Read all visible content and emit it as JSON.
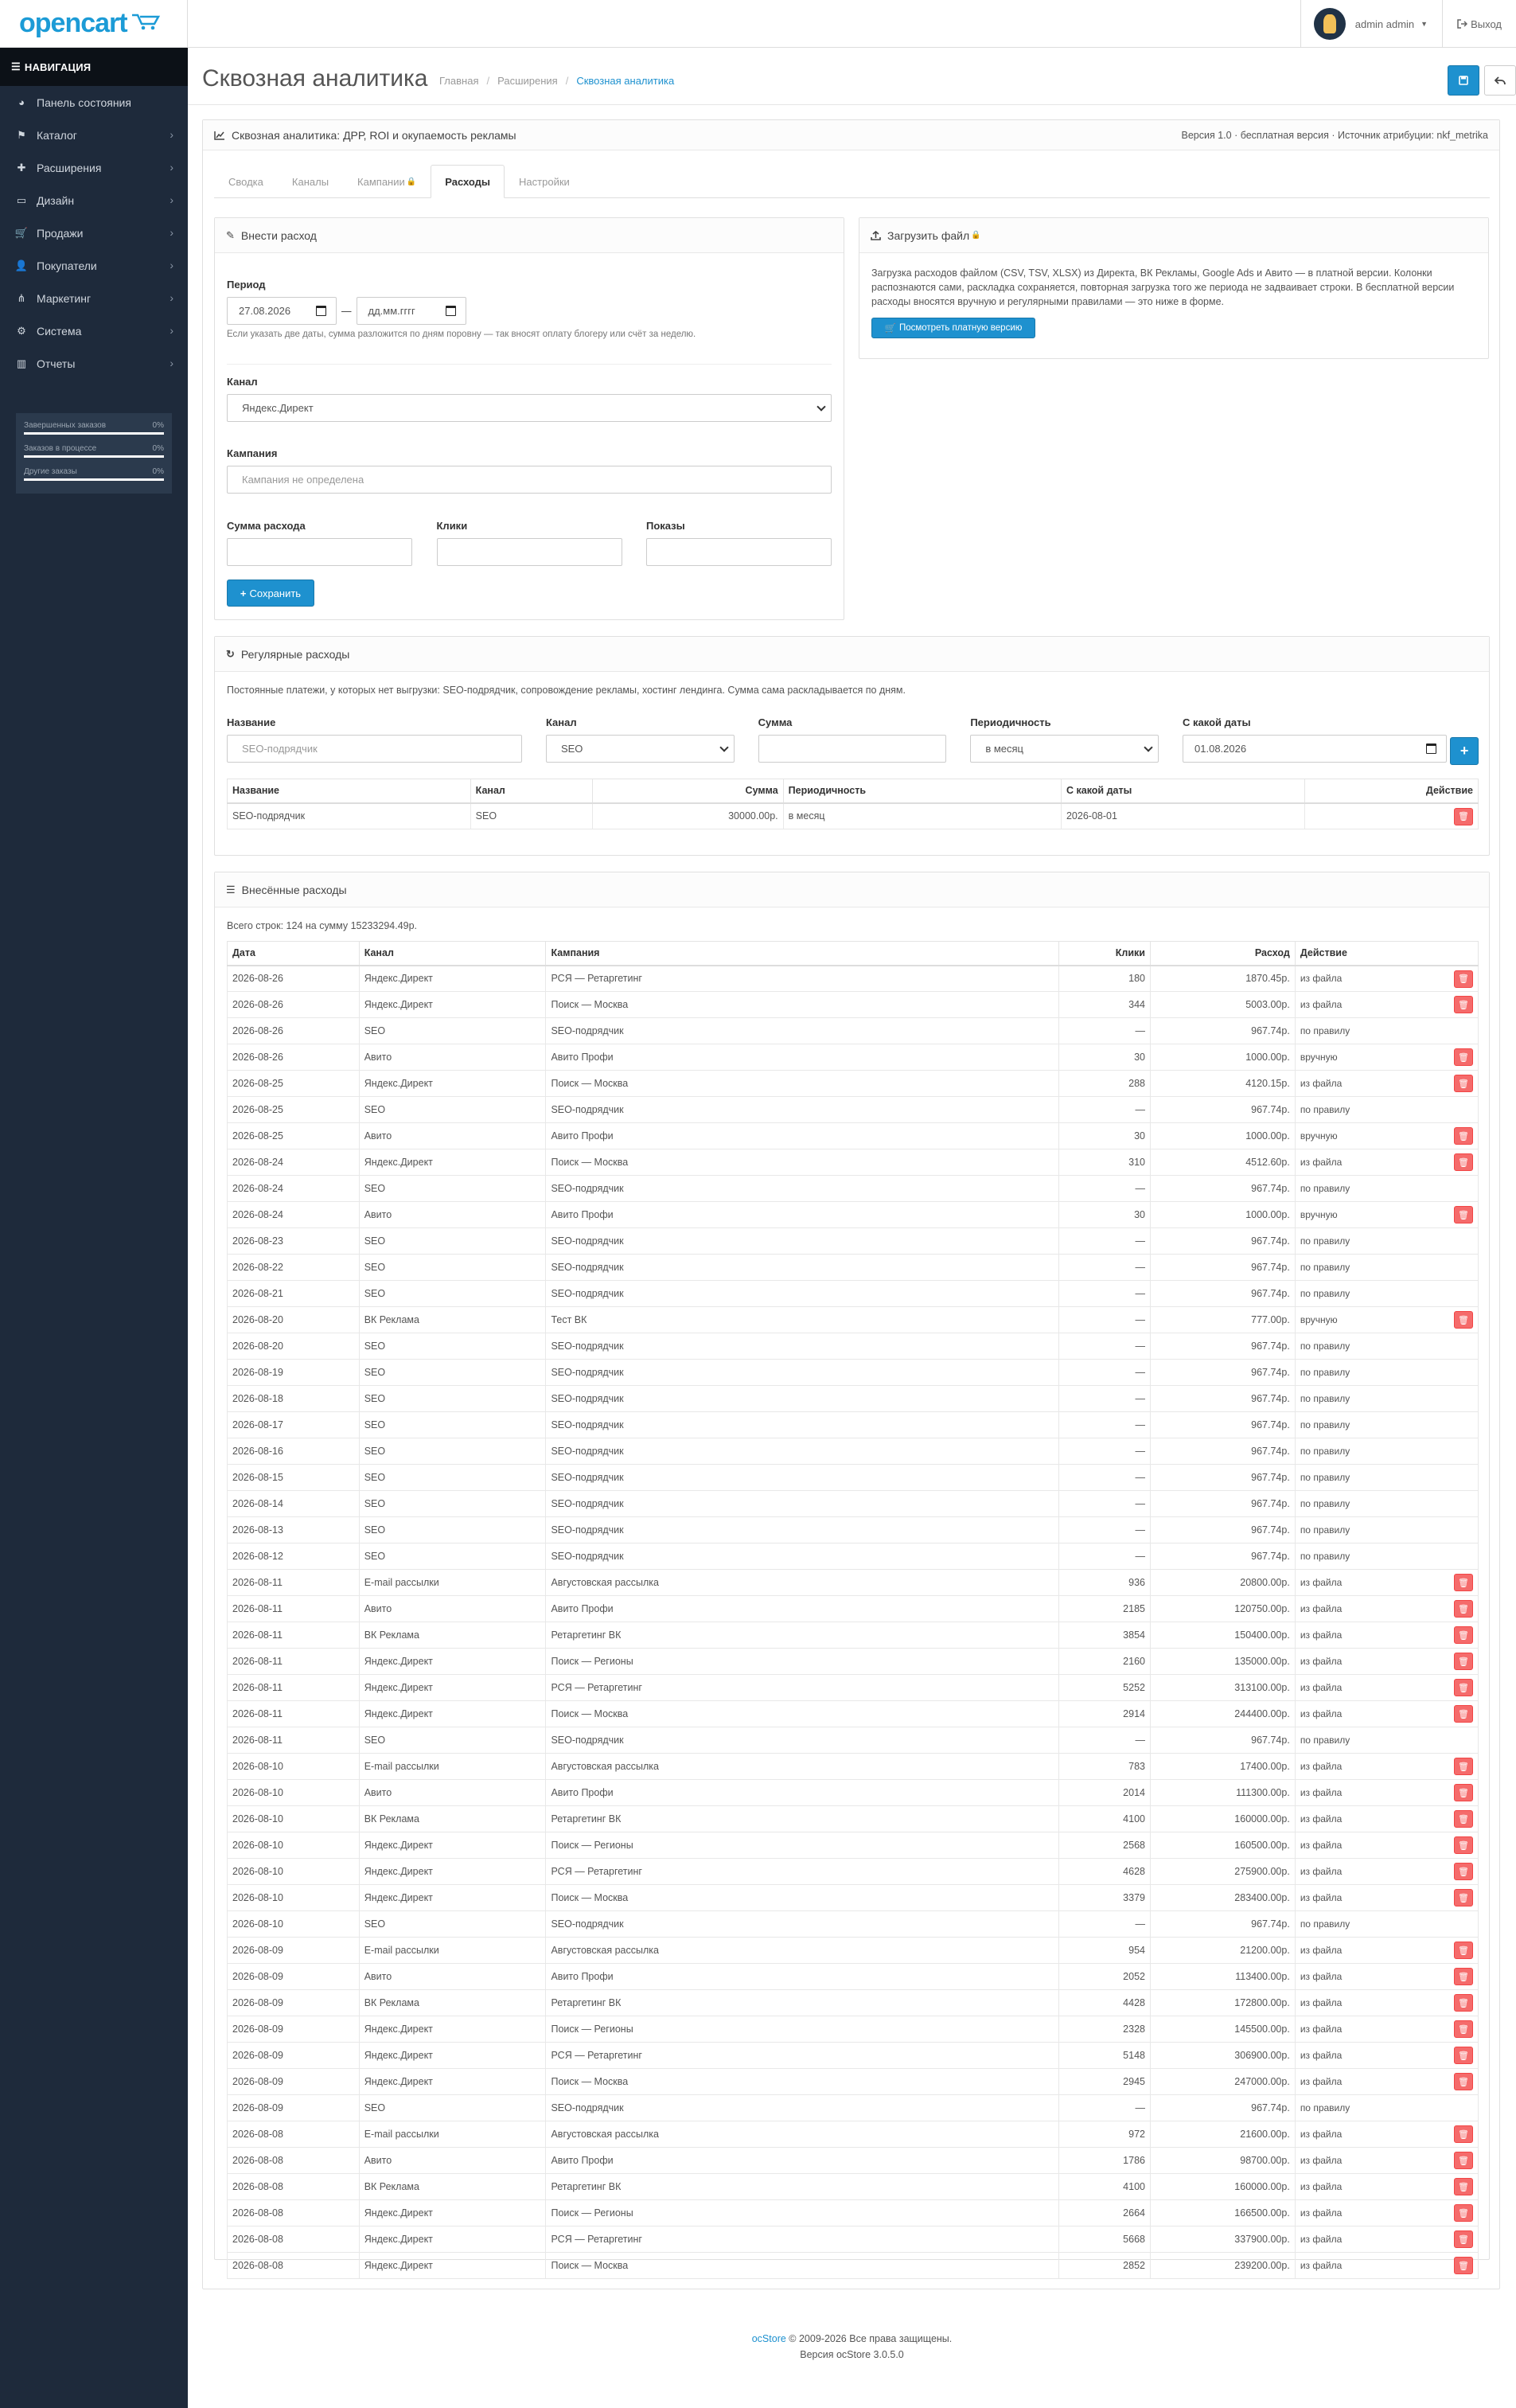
{
  "header": {
    "logo_text": "opencart",
    "user_name": "admin admin",
    "logout_label": "Выход"
  },
  "nav": {
    "title": "НАВИГАЦИЯ",
    "items": [
      {
        "label": "Панель состояния",
        "icon": "dashboard-icon",
        "arrow": false
      },
      {
        "label": "Каталог",
        "icon": "tag-icon",
        "arrow": true
      },
      {
        "label": "Расширения",
        "icon": "puzzle-icon",
        "arrow": true
      },
      {
        "label": "Дизайн",
        "icon": "monitor-icon",
        "arrow": true
      },
      {
        "label": "Продажи",
        "icon": "cart-icon",
        "arrow": true
      },
      {
        "label": "Покупатели",
        "icon": "user-icon",
        "arrow": true
      },
      {
        "label": "Маркетинг",
        "icon": "share-icon",
        "arrow": true
      },
      {
        "label": "Система",
        "icon": "gear-icon",
        "arrow": true
      },
      {
        "label": "Отчеты",
        "icon": "bar-chart-icon",
        "arrow": true
      }
    ],
    "stats": [
      {
        "label": "Завершенных заказов",
        "value": "0%"
      },
      {
        "label": "Заказов в процессе",
        "value": "0%"
      },
      {
        "label": "Другие заказы",
        "value": "0%"
      }
    ]
  },
  "page": {
    "title": "Сквозная аналитика",
    "breadcrumb": [
      "Главная",
      "Расширения",
      "Сквозная аналитика"
    ]
  },
  "panel": {
    "title": "Сквозная аналитика: ДРР, ROI и окупаемость рекламы",
    "version": "Версия 1.0 · бесплатная версия · Источник атрибуции: nkf_metrika",
    "tabs": [
      "Сводка",
      "Каналы",
      "Кампании",
      "Расходы",
      "Настройки"
    ]
  },
  "add_expense": {
    "title": "Внести расход",
    "period_label": "Период",
    "date_from": "27.08.2026",
    "date_to_placeholder": "дд.мм.гггг",
    "dash": "—",
    "period_help": "Если указать две даты, сумма разложится по дням поровну — так вносят оплату блогеру или счёт за неделю.",
    "channel_label": "Канал",
    "channel_value": "Яндекс.Директ",
    "campaign_label": "Кампания",
    "campaign_placeholder": "Кампания не определена",
    "amount_label": "Сумма расхода",
    "clicks_label": "Клики",
    "impressions_label": "Показы",
    "save_label": "Сохранить"
  },
  "upload": {
    "title": "Загрузить файл",
    "text": "Загрузка расходов файлом (CSV, TSV, XLSX) из Директа, ВК Рекламы, Google Ads и Авито — в платной версии. Колонки распознаются сами, раскладка сохраняется, повторная загрузка того же периода не задваивает строки. В бесплатной версии расходы вносятся вручную и регулярными правилами — это ниже в форме.",
    "button": "Посмотреть платную версию"
  },
  "recurring": {
    "title": "Регулярные расходы",
    "description": "Постоянные платежи, у которых нет выгрузки: SEO-подрядчик, сопровождение рекламы, хостинг лендинга. Сумма сама раскладывается по дням.",
    "labels": {
      "name": "Название",
      "channel": "Канал",
      "amount": "Сумма",
      "period": "Периодичность",
      "since": "С какой даты"
    },
    "name_placeholder": "SEO-подрядчик",
    "channel_value": "SEO",
    "period_value": "в месяц",
    "since_value": "01.08.2026",
    "columns": [
      "Название",
      "Канал",
      "Сумма",
      "Периодичность",
      "С какой даты",
      "Действие"
    ],
    "rows": [
      {
        "name": "SEO-подрядчик",
        "channel": "SEO",
        "amount": "30000.00р.",
        "period": "в месяц",
        "since": "2026-08-01"
      }
    ]
  },
  "entered": {
    "title": "Внесённые расходы",
    "summary": "Всего строк: 124 на сумму 15233294.49р.",
    "columns": [
      "Дата",
      "Канал",
      "Кампания",
      "Клики",
      "Расход",
      "Действие"
    ],
    "rows": [
      {
        "date": "2026-08-26",
        "channel": "Яндекс.Директ",
        "campaign": "РСЯ — Ретаргетинг",
        "clicks": "180",
        "cost": "1870.45р.",
        "source": "из файла",
        "del": true
      },
      {
        "date": "2026-08-26",
        "channel": "Яндекс.Директ",
        "campaign": "Поиск — Москва",
        "clicks": "344",
        "cost": "5003.00р.",
        "source": "из файла",
        "del": true
      },
      {
        "date": "2026-08-26",
        "channel": "SEO",
        "campaign": "SEO-подрядчик",
        "clicks": "—",
        "cost": "967.74р.",
        "source": "по правилу",
        "del": false
      },
      {
        "date": "2026-08-26",
        "channel": "Авито",
        "campaign": "Авито Профи",
        "clicks": "30",
        "cost": "1000.00р.",
        "source": "вручную",
        "del": true
      },
      {
        "date": "2026-08-25",
        "channel": "Яндекс.Директ",
        "campaign": "Поиск — Москва",
        "clicks": "288",
        "cost": "4120.15р.",
        "source": "из файла",
        "del": true
      },
      {
        "date": "2026-08-25",
        "channel": "SEO",
        "campaign": "SEO-подрядчик",
        "clicks": "—",
        "cost": "967.74р.",
        "source": "по правилу",
        "del": false
      },
      {
        "date": "2026-08-25",
        "channel": "Авито",
        "campaign": "Авито Профи",
        "clicks": "30",
        "cost": "1000.00р.",
        "source": "вручную",
        "del": true
      },
      {
        "date": "2026-08-24",
        "channel": "Яндекс.Директ",
        "campaign": "Поиск — Москва",
        "clicks": "310",
        "cost": "4512.60р.",
        "source": "из файла",
        "del": true
      },
      {
        "date": "2026-08-24",
        "channel": "SEO",
        "campaign": "SEO-подрядчик",
        "clicks": "—",
        "cost": "967.74р.",
        "source": "по правилу",
        "del": false
      },
      {
        "date": "2026-08-24",
        "channel": "Авито",
        "campaign": "Авито Профи",
        "clicks": "30",
        "cost": "1000.00р.",
        "source": "вручную",
        "del": true
      },
      {
        "date": "2026-08-23",
        "channel": "SEO",
        "campaign": "SEO-подрядчик",
        "clicks": "—",
        "cost": "967.74р.",
        "source": "по правилу",
        "del": false
      },
      {
        "date": "2026-08-22",
        "channel": "SEO",
        "campaign": "SEO-подрядчик",
        "clicks": "—",
        "cost": "967.74р.",
        "source": "по правилу",
        "del": false
      },
      {
        "date": "2026-08-21",
        "channel": "SEO",
        "campaign": "SEO-подрядчик",
        "clicks": "—",
        "cost": "967.74р.",
        "source": "по правилу",
        "del": false
      },
      {
        "date": "2026-08-20",
        "channel": "ВК Реклама",
        "campaign": "Тест ВК",
        "clicks": "—",
        "cost": "777.00р.",
        "source": "вручную",
        "del": true
      },
      {
        "date": "2026-08-20",
        "channel": "SEO",
        "campaign": "SEO-подрядчик",
        "clicks": "—",
        "cost": "967.74р.",
        "source": "по правилу",
        "del": false
      },
      {
        "date": "2026-08-19",
        "channel": "SEO",
        "campaign": "SEO-подрядчик",
        "clicks": "—",
        "cost": "967.74р.",
        "source": "по правилу",
        "del": false
      },
      {
        "date": "2026-08-18",
        "channel": "SEO",
        "campaign": "SEO-подрядчик",
        "clicks": "—",
        "cost": "967.74р.",
        "source": "по правилу",
        "del": false
      },
      {
        "date": "2026-08-17",
        "channel": "SEO",
        "campaign": "SEO-подрядчик",
        "clicks": "—",
        "cost": "967.74р.",
        "source": "по правилу",
        "del": false
      },
      {
        "date": "2026-08-16",
        "channel": "SEO",
        "campaign": "SEO-подрядчик",
        "clicks": "—",
        "cost": "967.74р.",
        "source": "по правилу",
        "del": false
      },
      {
        "date": "2026-08-15",
        "channel": "SEO",
        "campaign": "SEO-подрядчик",
        "clicks": "—",
        "cost": "967.74р.",
        "source": "по правилу",
        "del": false
      },
      {
        "date": "2026-08-14",
        "channel": "SEO",
        "campaign": "SEO-подрядчик",
        "clicks": "—",
        "cost": "967.74р.",
        "source": "по правилу",
        "del": false
      },
      {
        "date": "2026-08-13",
        "channel": "SEO",
        "campaign": "SEO-подрядчик",
        "clicks": "—",
        "cost": "967.74р.",
        "source": "по правилу",
        "del": false
      },
      {
        "date": "2026-08-12",
        "channel": "SEO",
        "campaign": "SEO-подрядчик",
        "clicks": "—",
        "cost": "967.74р.",
        "source": "по правилу",
        "del": false
      },
      {
        "date": "2026-08-11",
        "channel": "E-mail рассылки",
        "campaign": "Августовская рассылка",
        "clicks": "936",
        "cost": "20800.00р.",
        "source": "из файла",
        "del": true
      },
      {
        "date": "2026-08-11",
        "channel": "Авито",
        "campaign": "Авито Профи",
        "clicks": "2185",
        "cost": "120750.00р.",
        "source": "из файла",
        "del": true
      },
      {
        "date": "2026-08-11",
        "channel": "ВК Реклама",
        "campaign": "Ретаргетинг ВК",
        "clicks": "3854",
        "cost": "150400.00р.",
        "source": "из файла",
        "del": true
      },
      {
        "date": "2026-08-11",
        "channel": "Яндекс.Директ",
        "campaign": "Поиск — Регионы",
        "clicks": "2160",
        "cost": "135000.00р.",
        "source": "из файла",
        "del": true
      },
      {
        "date": "2026-08-11",
        "channel": "Яндекс.Директ",
        "campaign": "РСЯ — Ретаргетинг",
        "clicks": "5252",
        "cost": "313100.00р.",
        "source": "из файла",
        "del": true
      },
      {
        "date": "2026-08-11",
        "channel": "Яндекс.Директ",
        "campaign": "Поиск — Москва",
        "clicks": "2914",
        "cost": "244400.00р.",
        "source": "из файла",
        "del": true
      },
      {
        "date": "2026-08-11",
        "channel": "SEO",
        "campaign": "SEO-подрядчик",
        "clicks": "—",
        "cost": "967.74р.",
        "source": "по правилу",
        "del": false
      },
      {
        "date": "2026-08-10",
        "channel": "E-mail рассылки",
        "campaign": "Августовская рассылка",
        "clicks": "783",
        "cost": "17400.00р.",
        "source": "из файла",
        "del": true
      },
      {
        "date": "2026-08-10",
        "channel": "Авито",
        "campaign": "Авито Профи",
        "clicks": "2014",
        "cost": "111300.00р.",
        "source": "из файла",
        "del": true
      },
      {
        "date": "2026-08-10",
        "channel": "ВК Реклама",
        "campaign": "Ретаргетинг ВК",
        "clicks": "4100",
        "cost": "160000.00р.",
        "source": "из файла",
        "del": true
      },
      {
        "date": "2026-08-10",
        "channel": "Яндекс.Директ",
        "campaign": "Поиск — Регионы",
        "clicks": "2568",
        "cost": "160500.00р.",
        "source": "из файла",
        "del": true
      },
      {
        "date": "2026-08-10",
        "channel": "Яндекс.Директ",
        "campaign": "РСЯ — Ретаргетинг",
        "clicks": "4628",
        "cost": "275900.00р.",
        "source": "из файла",
        "del": true
      },
      {
        "date": "2026-08-10",
        "channel": "Яндекс.Директ",
        "campaign": "Поиск — Москва",
        "clicks": "3379",
        "cost": "283400.00р.",
        "source": "из файла",
        "del": true
      },
      {
        "date": "2026-08-10",
        "channel": "SEO",
        "campaign": "SEO-подрядчик",
        "clicks": "—",
        "cost": "967.74р.",
        "source": "по правилу",
        "del": false
      },
      {
        "date": "2026-08-09",
        "channel": "E-mail рассылки",
        "campaign": "Августовская рассылка",
        "clicks": "954",
        "cost": "21200.00р.",
        "source": "из файла",
        "del": true
      },
      {
        "date": "2026-08-09",
        "channel": "Авито",
        "campaign": "Авито Профи",
        "clicks": "2052",
        "cost": "113400.00р.",
        "source": "из файла",
        "del": true
      },
      {
        "date": "2026-08-09",
        "channel": "ВК Реклама",
        "campaign": "Ретаргетинг ВК",
        "clicks": "4428",
        "cost": "172800.00р.",
        "source": "из файла",
        "del": true
      },
      {
        "date": "2026-08-09",
        "channel": "Яндекс.Директ",
        "campaign": "Поиск — Регионы",
        "clicks": "2328",
        "cost": "145500.00р.",
        "source": "из файла",
        "del": true
      },
      {
        "date": "2026-08-09",
        "channel": "Яндекс.Директ",
        "campaign": "РСЯ — Ретаргетинг",
        "clicks": "5148",
        "cost": "306900.00р.",
        "source": "из файла",
        "del": true
      },
      {
        "date": "2026-08-09",
        "channel": "Яндекс.Директ",
        "campaign": "Поиск — Москва",
        "clicks": "2945",
        "cost": "247000.00р.",
        "source": "из файла",
        "del": true
      },
      {
        "date": "2026-08-09",
        "channel": "SEO",
        "campaign": "SEO-подрядчик",
        "clicks": "—",
        "cost": "967.74р.",
        "source": "по правилу",
        "del": false
      },
      {
        "date": "2026-08-08",
        "channel": "E-mail рассылки",
        "campaign": "Августовская рассылка",
        "clicks": "972",
        "cost": "21600.00р.",
        "source": "из файла",
        "del": true
      },
      {
        "date": "2026-08-08",
        "channel": "Авито",
        "campaign": "Авито Профи",
        "clicks": "1786",
        "cost": "98700.00р.",
        "source": "из файла",
        "del": true
      },
      {
        "date": "2026-08-08",
        "channel": "ВК Реклама",
        "campaign": "Ретаргетинг ВК",
        "clicks": "4100",
        "cost": "160000.00р.",
        "source": "из файла",
        "del": true
      },
      {
        "date": "2026-08-08",
        "channel": "Яндекс.Директ",
        "campaign": "Поиск — Регионы",
        "clicks": "2664",
        "cost": "166500.00р.",
        "source": "из файла",
        "del": true
      },
      {
        "date": "2026-08-08",
        "channel": "Яндекс.Директ",
        "campaign": "РСЯ — Ретаргетинг",
        "clicks": "5668",
        "cost": "337900.00р.",
        "source": "из файла",
        "del": true
      },
      {
        "date": "2026-08-08",
        "channel": "Яндекс.Директ",
        "campaign": "Поиск — Москва",
        "clicks": "2852",
        "cost": "239200.00р.",
        "source": "из файла",
        "del": true
      }
    ]
  },
  "footer": {
    "brand": "ocStore",
    "copyright": " © 2009-2026 Все права защищены.",
    "version": "Версия ocStore 3.0.5.0"
  }
}
